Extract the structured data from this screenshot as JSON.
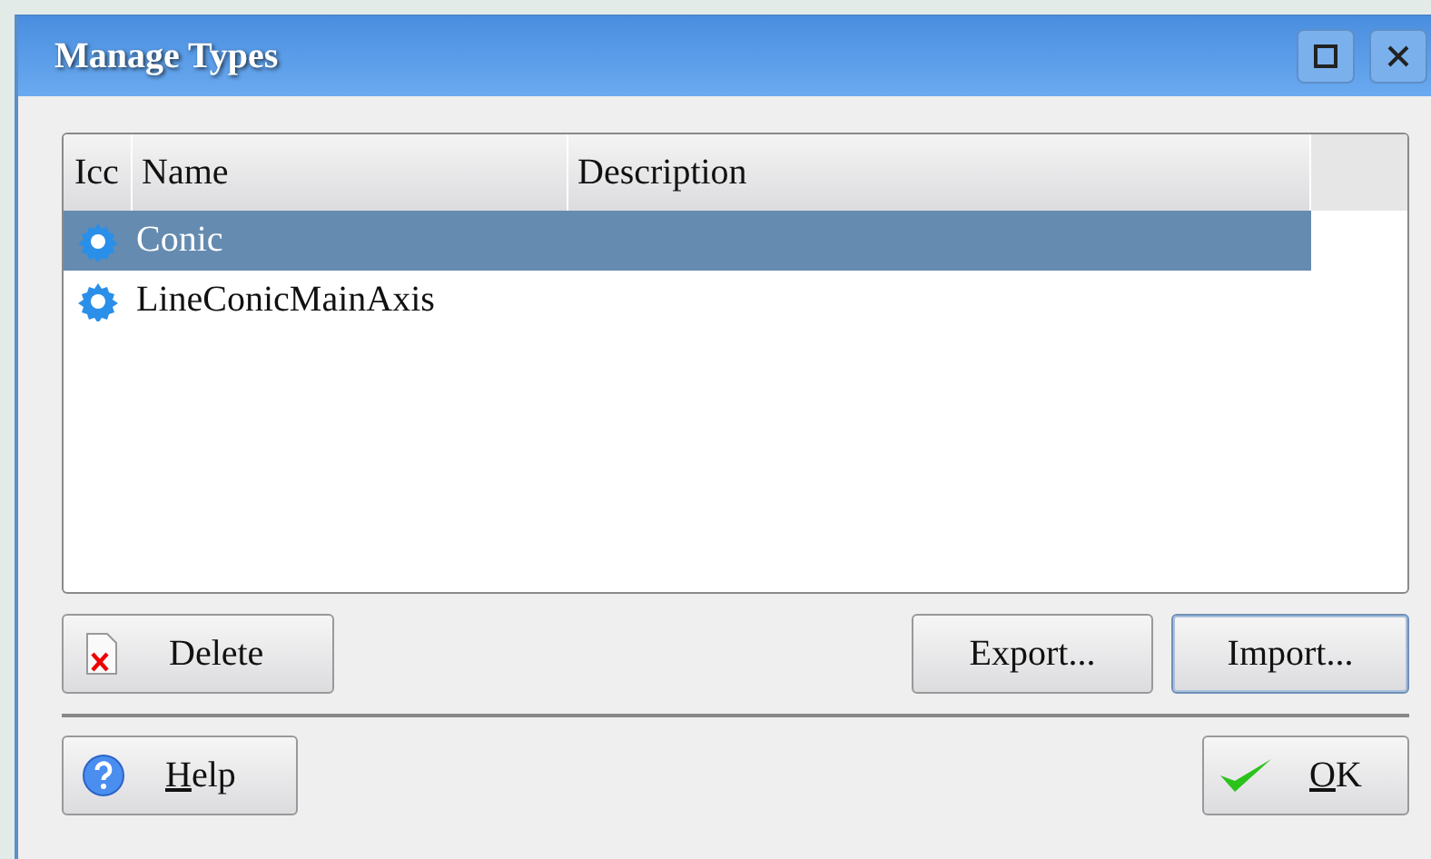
{
  "window": {
    "title": "Manage Types"
  },
  "table": {
    "columns": [
      "Icc",
      "Name",
      "Description"
    ],
    "rows": [
      {
        "name": "Conic",
        "description": "",
        "selected": true
      },
      {
        "name": "LineConicMainAxis",
        "description": "",
        "selected": false
      }
    ]
  },
  "buttons": [
    {
      "kind": "delete",
      "label": "Delete",
      "default": false
    },
    {
      "kind": "export",
      "label": "Export...",
      "default": false
    },
    {
      "kind": "import",
      "label": "Import...",
      "default": true
    }
  ],
  "footer_buttons": [
    {
      "kind": "help",
      "mnemonic": "H",
      "rest": "elp"
    },
    {
      "kind": "ok",
      "mnemonic": "O",
      "rest": "K"
    }
  ]
}
